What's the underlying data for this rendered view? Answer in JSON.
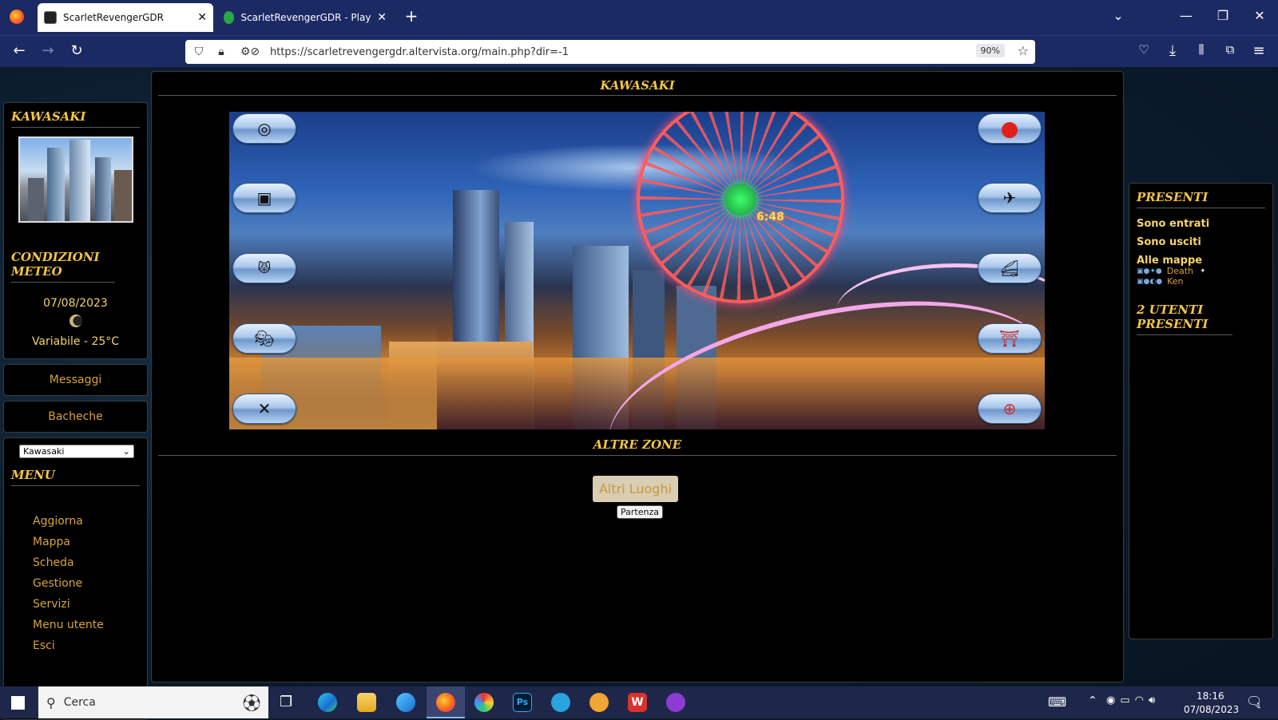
{
  "browser": {
    "tabs": [
      {
        "title": "ScarletRevengerGDR",
        "active": true
      },
      {
        "title": "ScarletRevengerGDR - Play by C",
        "active": false
      }
    ],
    "url": "https://scarletrevengergdr.altervista.org/main.php?dir=-1",
    "zoom": "90%"
  },
  "left": {
    "location_title": "KAWASAKI",
    "weather_title": "CONDIZIONI METEO",
    "date": "07/08/2023",
    "weather": "Variabile - 25°C",
    "messages": "Messaggi",
    "boards": "Bacheche",
    "select_value": "Kawasaki",
    "menu_title": "MENU",
    "menu": [
      "Aggiorna",
      "Mappa",
      "Scheda",
      "Gestione",
      "Servizi",
      "Menu utente",
      "Esci"
    ]
  },
  "center": {
    "title": "KAWASAKI",
    "clock": "6:48",
    "other_zones_title": "ALTRE ZONE",
    "other_places_button": "Altri Luoghi",
    "tooltip": "Partenza",
    "left_buttons": [
      "target-icon",
      "console-icon",
      "tiger-icon",
      "theater-masks-icon",
      "cutlery-icon"
    ],
    "right_buttons": [
      "japan-flag-icon",
      "airplane-icon",
      "train-icon",
      "torii-icon",
      "lifebuoy-icon"
    ]
  },
  "right": {
    "title": "PRESENTI",
    "entered": "Sono entrati",
    "exited": "Sono usciti",
    "all_maps": "Alle mappe",
    "users": [
      "Death",
      "Ken"
    ],
    "count": "2 UTENTI PRESENTI"
  },
  "taskbar": {
    "search": "Cerca",
    "time": "18:16",
    "date": "07/08/2023",
    "notifications": "1"
  }
}
